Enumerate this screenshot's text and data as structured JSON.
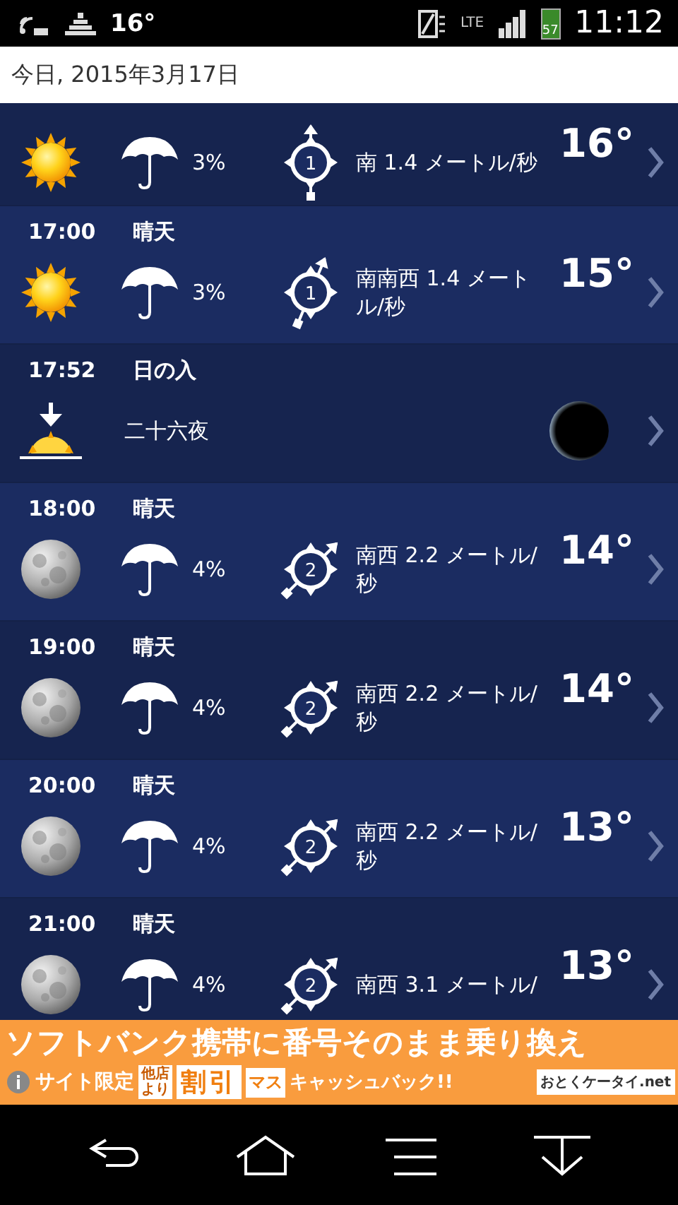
{
  "status_bar": {
    "temperature": "16°",
    "network": "LTE",
    "battery": "57",
    "time": "11:12"
  },
  "date_header": "今日, 2015年3月17日",
  "rows": [
    {
      "kind": "day",
      "precip": "3%",
      "wind_number": "1",
      "wind": "南 1.4 メートル/秒",
      "temp": "16°"
    },
    {
      "kind": "day",
      "time": "17:00",
      "condition": "晴天",
      "precip": "3%",
      "wind_number": "1",
      "wind": "南南西 1.4 メートル/秒",
      "temp": "15°"
    },
    {
      "kind": "sunset",
      "time": "17:52",
      "condition": "日の入",
      "detail": "二十六夜"
    },
    {
      "kind": "night",
      "time": "18:00",
      "condition": "晴天",
      "precip": "4%",
      "wind_number": "2",
      "wind": "南西 2.2 メートル/秒",
      "temp": "14°"
    },
    {
      "kind": "night",
      "time": "19:00",
      "condition": "晴天",
      "precip": "4%",
      "wind_number": "2",
      "wind": "南西 2.2 メートル/秒",
      "temp": "14°"
    },
    {
      "kind": "night",
      "time": "20:00",
      "condition": "晴天",
      "precip": "4%",
      "wind_number": "2",
      "wind": "南西 2.2 メートル/秒",
      "temp": "13°"
    },
    {
      "kind": "night",
      "time": "21:00",
      "condition": "晴天",
      "precip": "4%",
      "wind_number": "2",
      "wind": "南西 3.1 メートル/",
      "temp": "13°"
    }
  ],
  "ad": {
    "headline": "ソフトバンク携帯に番号そのまま乗り換え",
    "tag": "サイト限定",
    "small": "他店より",
    "highlight": "割引",
    "suffix": "マス",
    "cashback": "キャッシュバック!!",
    "logo": "おとくケータイ.net"
  }
}
